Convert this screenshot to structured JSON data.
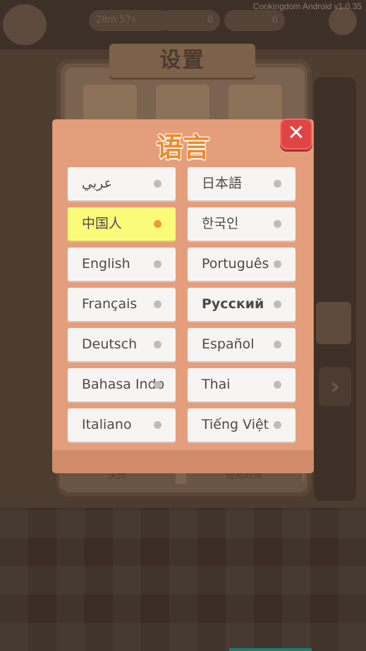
{
  "app": {
    "version": "Cookingdom Android v1.0.35"
  },
  "hud": {
    "timer": "28m 57s",
    "coins": "0",
    "stars": "0"
  },
  "settings": {
    "title": "设置",
    "bottom_left": "关闭",
    "bottom_right": "隐私政策"
  },
  "dialog": {
    "title": "语言",
    "close_symbol": "✕",
    "languages": [
      {
        "label": "عربي",
        "selected": false
      },
      {
        "label": "日本語",
        "selected": false
      },
      {
        "label": "中国人",
        "selected": true
      },
      {
        "label": "한국인",
        "selected": false
      },
      {
        "label": "English",
        "selected": false
      },
      {
        "label": "Português",
        "selected": false
      },
      {
        "label": "Français",
        "selected": false
      },
      {
        "label": "Русский",
        "selected": false
      },
      {
        "label": "Deutsch",
        "selected": false
      },
      {
        "label": "Español",
        "selected": false
      },
      {
        "label": "Bahasa Indo",
        "selected": false
      },
      {
        "label": "Thai",
        "selected": false
      },
      {
        "label": "Italiano",
        "selected": false
      },
      {
        "label": "Tiếng Việt",
        "selected": false
      }
    ],
    "colors": {
      "selected_bg": "#fbfb7a",
      "selected_dot": "#f39a2e",
      "title_color": "#f08a2a"
    }
  },
  "icons": {
    "close": "close-icon",
    "arrow": "chevron-right-icon",
    "lock": "lock-icon"
  }
}
